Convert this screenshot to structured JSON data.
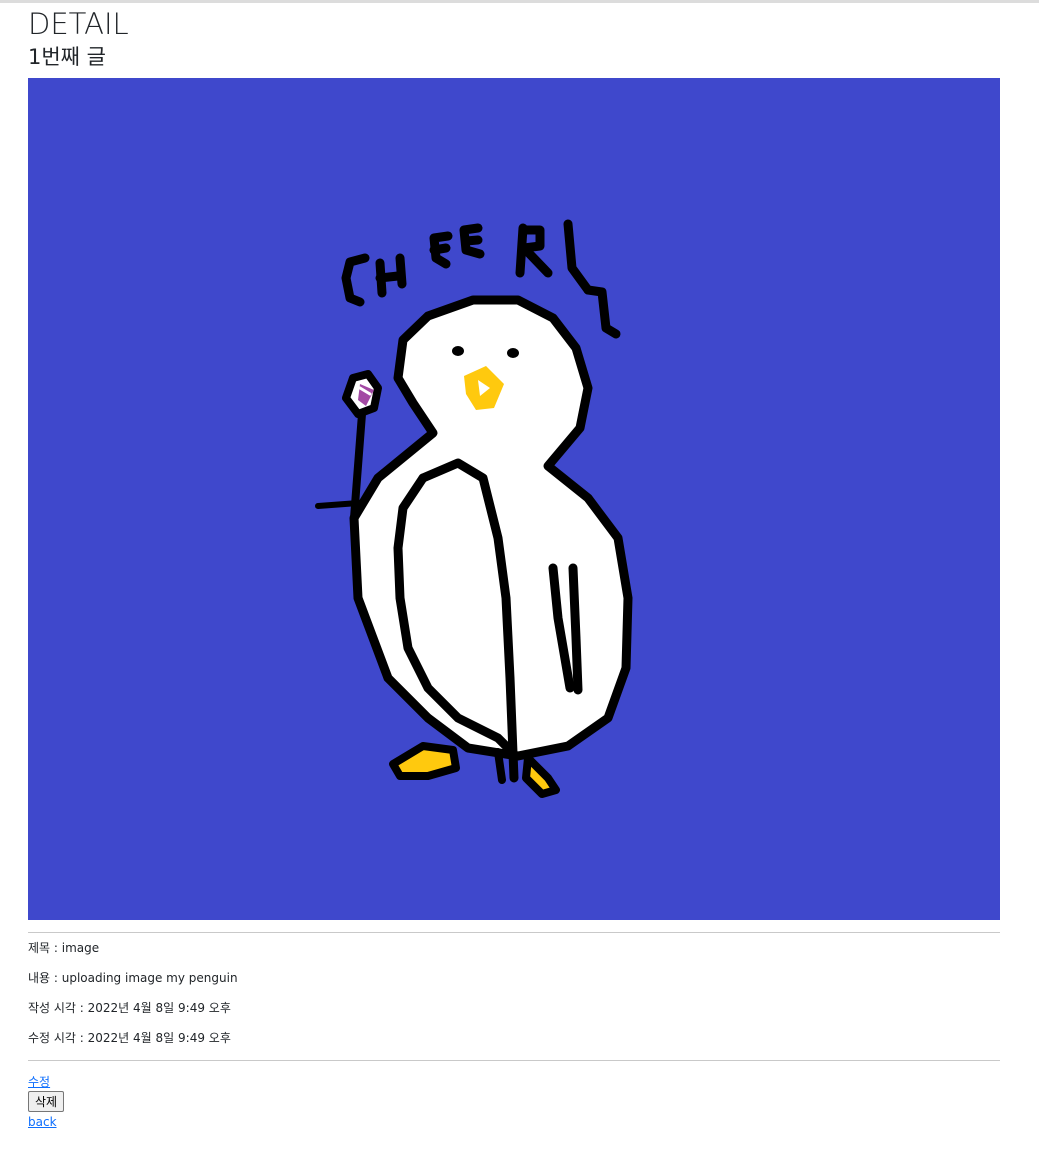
{
  "page": {
    "title": "DETAIL",
    "subtitle": "1번째 글"
  },
  "image": {
    "background": "#3f48cc",
    "drawn_text": "CHEERL"
  },
  "details": {
    "title_line": "제목 : image",
    "content_line": "내용 : uploading image my penguin",
    "created_line": "작성 시각 : 2022년 4월 8일 9:49 오후",
    "updated_line": "수정 시각 : 2022년 4월 8일 9:49 오후"
  },
  "actions": {
    "edit_label": "수정",
    "delete_label": "삭제",
    "back_label": "back"
  },
  "colors": {
    "link": "#0d6efd",
    "accent_beak": "#ffc90e"
  }
}
